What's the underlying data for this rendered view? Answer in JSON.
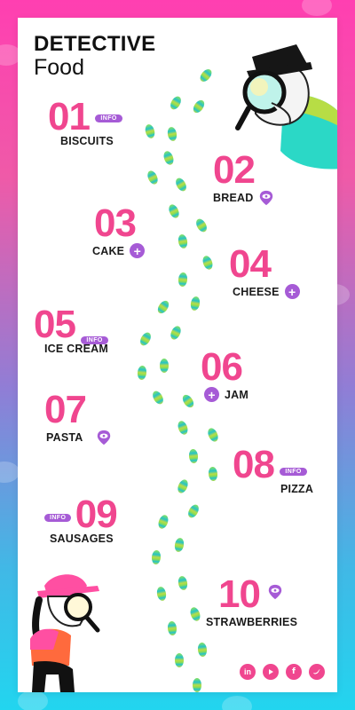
{
  "header": {
    "title_bold": "DETECTIVE",
    "title_light": "Food"
  },
  "items": [
    {
      "number": "01",
      "label": "BISCUITS",
      "marker": "INFO"
    },
    {
      "number": "02",
      "label": "BREAD",
      "marker": "eye"
    },
    {
      "number": "03",
      "label": "CAKE",
      "marker": "plus"
    },
    {
      "number": "04",
      "label": "CHEESE",
      "marker": "plus"
    },
    {
      "number": "05",
      "label": "ICE CREAM",
      "marker": "INFO"
    },
    {
      "number": "06",
      "label": "JAM",
      "marker": "plus"
    },
    {
      "number": "07",
      "label": "PASTA",
      "marker": "eye"
    },
    {
      "number": "08",
      "label": "PIZZA",
      "marker": "INFO"
    },
    {
      "number": "09",
      "label": "SAUSAGES",
      "marker": "INFO"
    },
    {
      "number": "10",
      "label": "STRAWBERRIES",
      "marker": "eye"
    }
  ],
  "badge_text": "INFO",
  "social": [
    "in",
    "yt",
    "f",
    "tw"
  ],
  "colors": {
    "pink": "#f0468f",
    "purple": "#a65bd6"
  }
}
